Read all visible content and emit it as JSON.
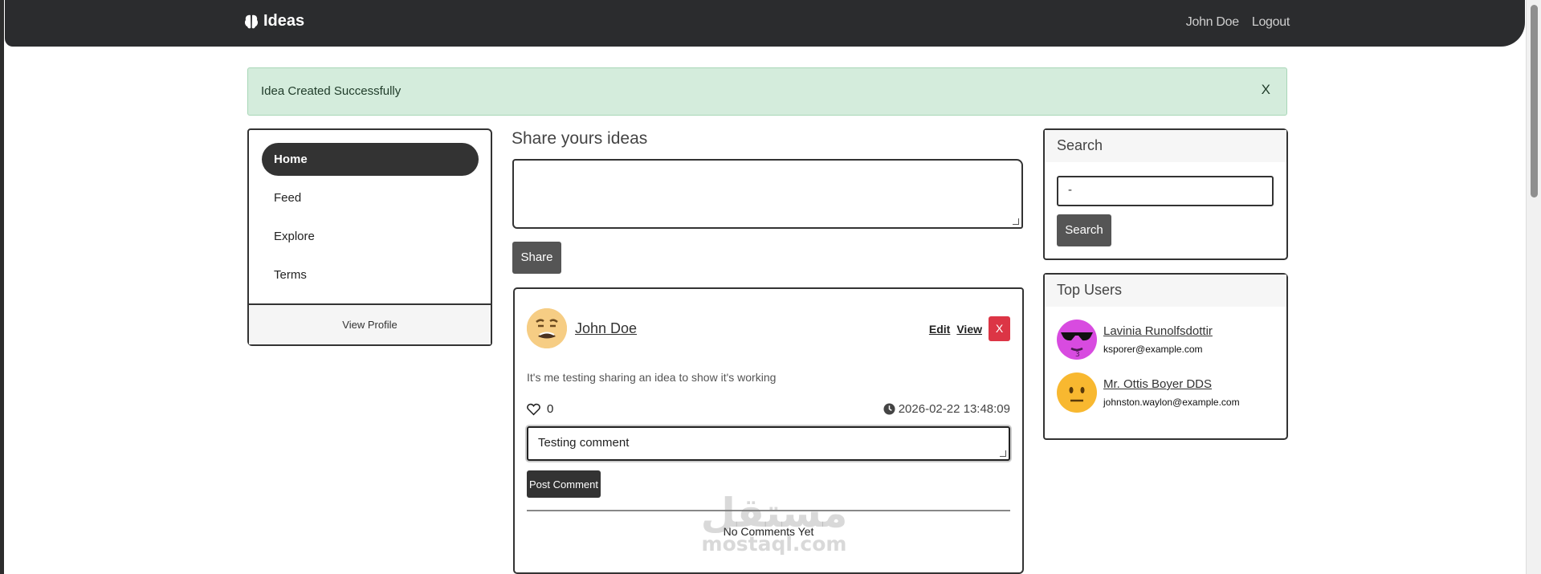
{
  "navbar": {
    "brand": "Ideas",
    "brand_icon": "brain-icon",
    "user_name": "John Doe",
    "logout": "Logout"
  },
  "alert": {
    "message": "Idea Created Successfully",
    "close": "X"
  },
  "sidebar": {
    "items": [
      {
        "label": "Home",
        "active": true
      },
      {
        "label": "Feed"
      },
      {
        "label": "Explore"
      },
      {
        "label": "Terms"
      }
    ],
    "footer": "View Profile"
  },
  "share": {
    "title": "Share yours ideas",
    "input_value": "",
    "button": "Share"
  },
  "post": {
    "author": "John Doe",
    "avatar_icon": "emoji-screaming-icon",
    "edit": "Edit",
    "view": "View",
    "delete": "X",
    "content": "It's me testing sharing an idea to show it's working",
    "likes": "0",
    "date": "2026-02-22 13:48:09",
    "comment_value": "Testing comment",
    "post_comment": "Post Comment",
    "no_comments": "No Comments Yet"
  },
  "search": {
    "title": "Search",
    "input_value": "-",
    "button": "Search"
  },
  "top_users": {
    "title": "Top Users",
    "users": [
      {
        "name": "Lavinia Runolfsdottir",
        "email": "ksporer@example.com",
        "avatar_color": "#d84be0"
      },
      {
        "name": "Mr. Ottis Boyer DDS",
        "email": "johnston.waylon@example.com",
        "avatar_color": "#f8b830"
      }
    ]
  },
  "watermark": {
    "arabic": "مستقل",
    "latin": "mostaql.com"
  },
  "colors": {
    "navbar": "#2b2c2e",
    "alert_bg": "#d4ecdc",
    "danger": "#dc3545",
    "button": "#555555"
  }
}
